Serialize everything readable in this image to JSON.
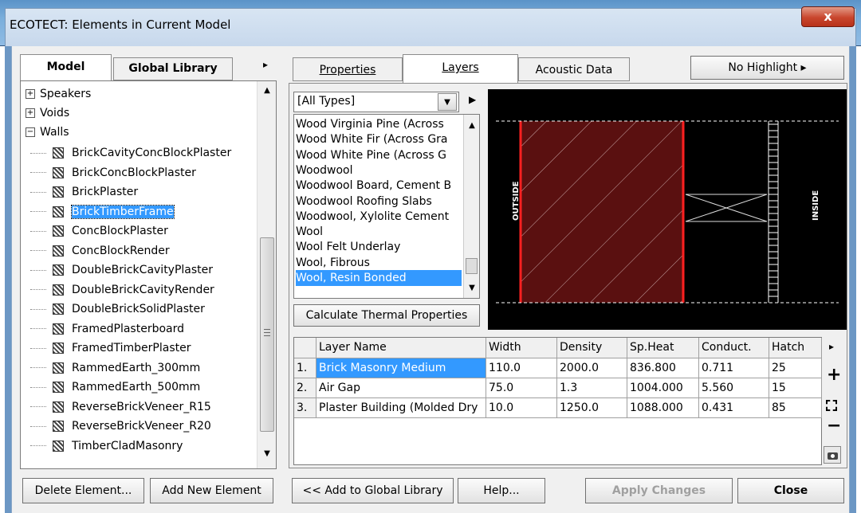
{
  "window": {
    "title": "ECOTECT: Elements in Current Model",
    "close_glyph": "x"
  },
  "left_tabs": {
    "model": "Model",
    "global_library": "Global Library",
    "more_arrow": "▸"
  },
  "tree": {
    "collapsed": [
      {
        "sign": "+",
        "label": "Speakers"
      },
      {
        "sign": "+",
        "label": "Voids"
      }
    ],
    "expanded": {
      "sign": "−",
      "label": "Walls"
    },
    "walls": [
      "BrickCavityConcBlockPlaster",
      "BrickConcBlockPlaster",
      "BrickPlaster",
      "BrickTimberFrame",
      "ConcBlockPlaster",
      "ConcBlockRender",
      "DoubleBrickCavityPlaster",
      "DoubleBrickCavityRender",
      "DoubleBrickSolidPlaster",
      "FramedPlasterboard",
      "FramedTimberPlaster",
      "RammedEarth_300mm",
      "RammedEarth_500mm",
      "ReverseBrickVeneer_R15",
      "ReverseBrickVeneer_R20",
      "TimberCladMasonry"
    ],
    "selected_index": 3
  },
  "right_tabs": {
    "properties": "Properties",
    "layers": "Layers",
    "acoustic": "Acoustic Data",
    "highlight": "No Highlight ▸"
  },
  "type_filter": {
    "value": "[All Types]"
  },
  "materials": [
    "Wood Virginia Pine (Across",
    "Wood White Fir (Across Gra",
    "Wood White Pine (Across G",
    "Woodwool",
    "Woodwool Board, Cement B",
    "Woodwool Roofing Slabs",
    "Woodwool, Xylolite Cement",
    "Wool",
    "Wool Felt Underlay",
    "Wool, Fibrous",
    "Wool, Resin Bonded"
  ],
  "materials_selected_index": 10,
  "calc_button": "Calculate Thermal Properties",
  "preview": {
    "outside": "OUTSIDE",
    "inside": "INSIDE",
    "fill_color": "#5a1010",
    "line_color": "#ff2020"
  },
  "table": {
    "headers": [
      "Layer Name",
      "Width",
      "Density",
      "Sp.Heat",
      "Conduct.",
      "Hatch"
    ],
    "rows": [
      {
        "num": "1.",
        "name": "Brick Masonry Medium",
        "width": "110.0",
        "density": "2000.0",
        "spheat": "836.800",
        "conduct": "0.711",
        "hatch": "25"
      },
      {
        "num": "2.",
        "name": "Air Gap",
        "width": "75.0",
        "density": "1.3",
        "spheat": "1004.000",
        "conduct": "5.560",
        "hatch": "15"
      },
      {
        "num": "3.",
        "name": "Plaster Building (Molded Dry",
        "width": "10.0",
        "density": "1250.0",
        "spheat": "1088.000",
        "conduct": "0.431",
        "hatch": "85"
      }
    ]
  },
  "side_tools": {
    "more": "▸",
    "add": "+",
    "expand": "⛶",
    "remove": "−"
  },
  "buttons": {
    "delete": "Delete Element...",
    "add_new": "Add New Element",
    "add_global": "<< Add to Global Library",
    "help": "Help...",
    "apply": "Apply Changes",
    "close": "Close"
  }
}
